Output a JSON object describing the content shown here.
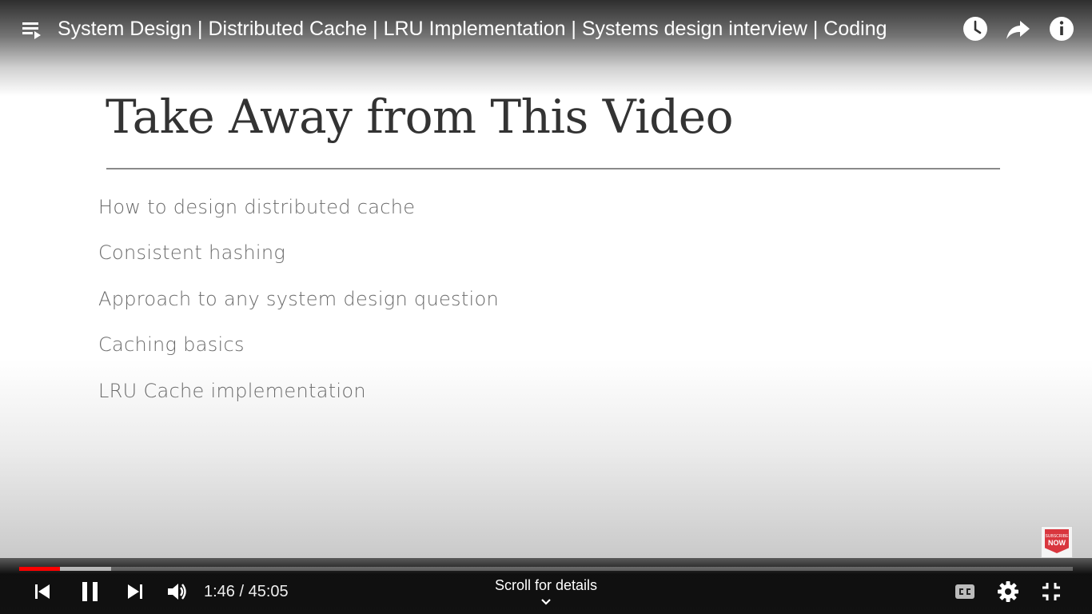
{
  "header": {
    "title": "System Design | Distributed Cache | LRU Implementation | Systems design interview | Coding",
    "icons": [
      "playlist-icon",
      "watch-later-icon",
      "share-icon",
      "info-icon"
    ]
  },
  "slide": {
    "title": "Take Away from This Video",
    "bullets": [
      "How to design distributed cache",
      "Consistent hashing",
      "Approach to any system design question",
      "Caching basics",
      "LRU Cache implementation"
    ]
  },
  "subscribe": {
    "small_text": "SUBSCRIBE",
    "now_text": "NOW"
  },
  "player": {
    "current_time": "1:46",
    "duration": "45:05",
    "time_text": "1:46 / 45:05",
    "played_fraction": 0.039,
    "buffered_fraction": 0.087,
    "scroll_label": "Scroll for details",
    "progress_color": "#ff0000",
    "control_icons": [
      "previous-icon",
      "pause-icon",
      "next-icon",
      "volume-icon",
      "captions-icon",
      "settings-icon",
      "exit-fullscreen-icon"
    ]
  }
}
